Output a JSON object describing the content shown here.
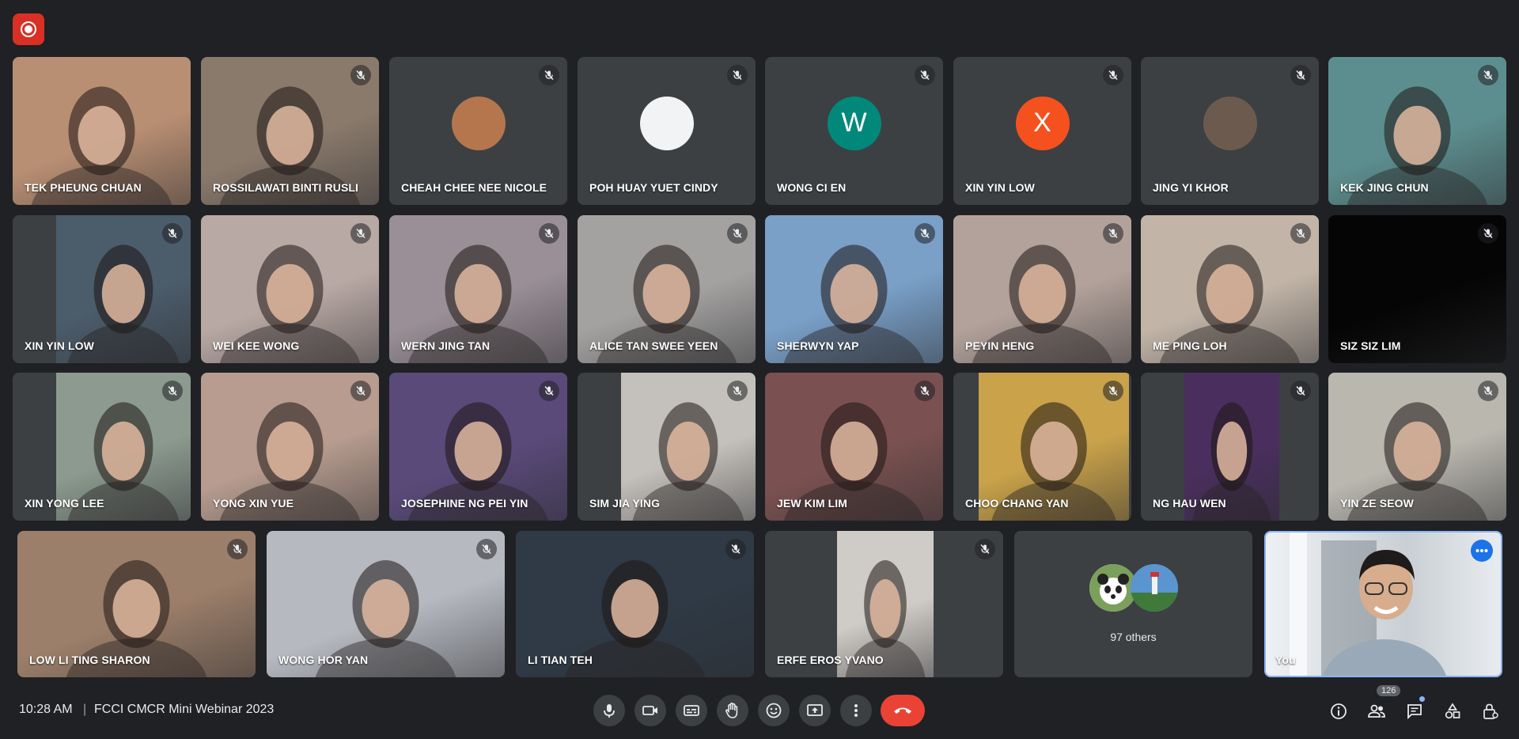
{
  "recording": {
    "icon": "record-icon"
  },
  "participants": [
    {
      "name": "TEK PHEUNG CHUAN",
      "muted": false,
      "bg": "#b98f73"
    },
    {
      "name": "ROSSILAWATI BINTI RUSLI",
      "muted": true,
      "bg": "#8a7a6c"
    },
    {
      "name": "CHEAH CHEE NEE NICOLE",
      "muted": true,
      "avatar_bg": "#b5764d"
    },
    {
      "name": "POH HUAY YUET CINDY",
      "muted": true,
      "avatar_bg": "#f1f3f4"
    },
    {
      "name": "WONG CI EN",
      "muted": true,
      "avatar_letter": "W",
      "avatar_bg": "#00897b"
    },
    {
      "name": "XIN YIN LOW",
      "muted": true,
      "avatar_letter": "X",
      "avatar_bg": "#f4511e"
    },
    {
      "name": "JING YI KHOR",
      "muted": true,
      "avatar_bg": "#6d5a4e"
    },
    {
      "name": "KEK JING CHUN",
      "muted": true,
      "bg": "#5d8e8f"
    },
    {
      "name": "XIN YIN LOW",
      "muted": true,
      "bg": "#4b5c6b"
    },
    {
      "name": "WEI KEE WONG",
      "muted": true,
      "bg": "#b9a9a4"
    },
    {
      "name": "WERN JING TAN",
      "muted": true,
      "bg": "#9a8f96"
    },
    {
      "name": "ALICE TAN SWEE YEEN",
      "muted": true,
      "bg": "#a4a2a1"
    },
    {
      "name": "SHERWYN YAP",
      "muted": true,
      "bg": "#7aa0c8"
    },
    {
      "name": "PEYIN HENG",
      "muted": true,
      "bg": "#b3a29b"
    },
    {
      "name": "ME PING LOH",
      "muted": true,
      "bg": "#c2b5a8"
    },
    {
      "name": "SIZ SIZ LIM",
      "muted": true,
      "bg": "#050505"
    },
    {
      "name": "XIN YONG LEE",
      "muted": true,
      "bg": "#8c9a8f"
    },
    {
      "name": "YONG XIN YUE",
      "muted": true,
      "bg": "#b79c8f"
    },
    {
      "name": "JOSEPHINE NG PEI YIN",
      "muted": true,
      "bg": "#5a4a7a"
    },
    {
      "name": "SIM JIA YING",
      "muted": true,
      "bg": "#c4c0bb"
    },
    {
      "name": "JEW KIM LIM",
      "muted": true,
      "bg": "#7a5150"
    },
    {
      "name": "CHOO CHANG YAN",
      "muted": true,
      "bg": "#c9a24a"
    },
    {
      "name": "NG HAU WEN",
      "muted": true,
      "bg": "#4a2f5e"
    },
    {
      "name": "YIN ZE SEOW",
      "muted": true,
      "bg": "#b9b7ae"
    },
    {
      "name": "LOW LI TING SHARON",
      "muted": true,
      "bg": "#9c7f6a"
    },
    {
      "name": "WONG HOR YAN",
      "muted": true,
      "bg": "#b6b9c0"
    },
    {
      "name": "LI TIAN TEH",
      "muted": true,
      "bg": "#2f3a46"
    },
    {
      "name": "ERFE EROS YVANO",
      "muted": true,
      "bg": "#cfcbc6"
    }
  ],
  "others_tile": {
    "label": "97 others"
  },
  "self_tile": {
    "name": "You",
    "more_icon": "more-options-icon",
    "bg": "#dfe4e8"
  },
  "bottom_bar": {
    "time": "10:28 AM",
    "separator": "|",
    "meeting_title": "FCCI CMCR Mini Webinar 2023",
    "people_count": "126"
  },
  "colors": {
    "background": "#202124",
    "tile": "#3c4043",
    "hangup": "#ea4335",
    "accent": "#8ab4f8"
  }
}
